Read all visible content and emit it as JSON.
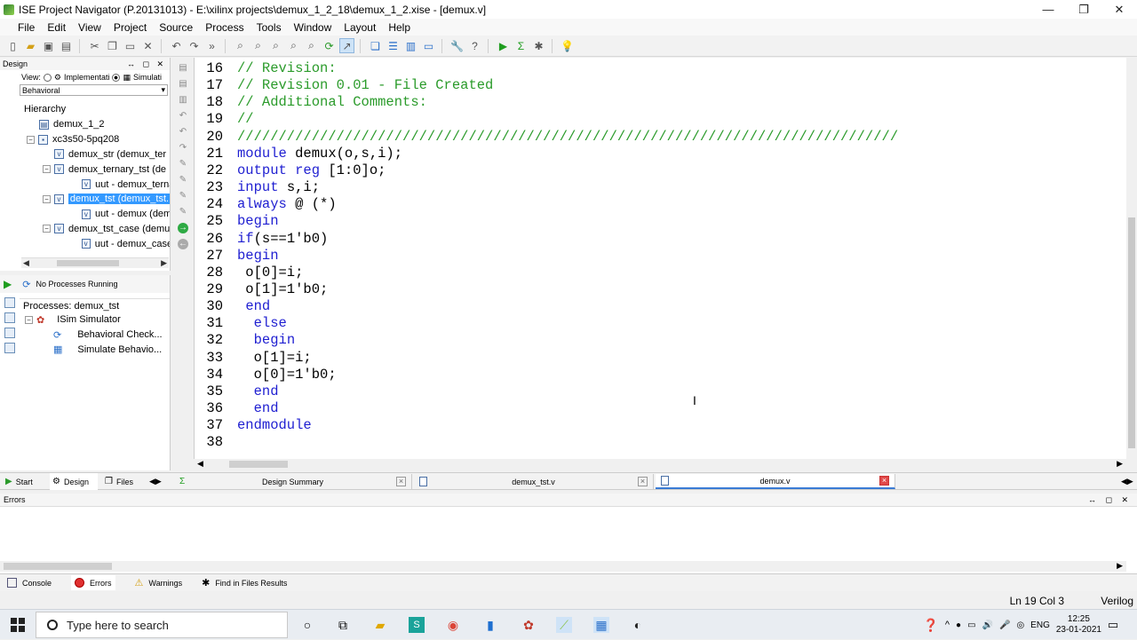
{
  "window": {
    "title": "ISE Project Navigator (P.20131013) - E:\\xilinx projects\\demux_1_2_18\\demux_1_2.xise - [demux.v]",
    "controls": [
      "—",
      "❐",
      "✕"
    ]
  },
  "menu": [
    "File",
    "Edit",
    "View",
    "Project",
    "Source",
    "Process",
    "Tools",
    "Window",
    "Layout",
    "Help"
  ],
  "design_panel": {
    "header": "Design",
    "controls": "↔ ◻ ✕",
    "view_label": "View:",
    "view_impl": "Implementati",
    "view_sim": "Simulati",
    "selected_view": "Behavioral",
    "hierarchy_title": "Hierarchy",
    "tree": [
      {
        "label": "demux_1_2",
        "indent": 1,
        "exp": "",
        "icon": "project"
      },
      {
        "label": "xc3s50-5pq208",
        "indent": 1,
        "exp": "⊟",
        "icon": "chip"
      },
      {
        "label": "demux_str (demux_ter",
        "indent": 2,
        "exp": "",
        "icon": "v"
      },
      {
        "label": "demux_ternary_tst (de",
        "indent": 2,
        "exp": "⊟",
        "icon": "v"
      },
      {
        "label": "uut - demux_ternai",
        "indent": 3,
        "exp": "",
        "icon": "v"
      },
      {
        "label": "demux_tst (demux_tst.",
        "indent": 2,
        "exp": "⊟",
        "icon": "v",
        "selected": true
      },
      {
        "label": "uut - demux (demu",
        "indent": 3,
        "exp": "",
        "icon": "v"
      },
      {
        "label": "demux_tst_case (demu",
        "indent": 2,
        "exp": "⊟",
        "icon": "v"
      },
      {
        "label": "uut - demux_case (",
        "indent": 3,
        "exp": "",
        "icon": "v"
      }
    ]
  },
  "process_panel": {
    "status": "No Processes Running",
    "title": "Processes: demux_tst",
    "items": [
      {
        "label": "ISim Simulator",
        "indent": 1
      },
      {
        "label": "Behavioral Check...",
        "indent": 2
      },
      {
        "label": "Simulate Behavio...",
        "indent": 2
      }
    ]
  },
  "editor": {
    "lines": [
      {
        "n": "16",
        "parts": [
          {
            "t": "// Revision:",
            "c": "cm"
          }
        ]
      },
      {
        "n": "17",
        "parts": [
          {
            "t": "// Revision 0.01 - File Created",
            "c": "cm"
          }
        ]
      },
      {
        "n": "18",
        "parts": [
          {
            "t": "// Additional Comments:",
            "c": "cm"
          }
        ]
      },
      {
        "n": "19",
        "parts": [
          {
            "t": "//",
            "c": "cm"
          }
        ]
      },
      {
        "n": "20",
        "parts": [
          {
            "t": "////////////////////////////////////////////////////////////////////////////////",
            "c": "cm"
          }
        ]
      },
      {
        "n": "21",
        "parts": [
          {
            "t": "module",
            "c": "kw"
          },
          {
            "t": " demux(o,s,i);",
            "c": ""
          }
        ]
      },
      {
        "n": "22",
        "parts": [
          {
            "t": "output reg",
            "c": "kw"
          },
          {
            "t": " [1:0]o;",
            "c": ""
          }
        ]
      },
      {
        "n": "23",
        "parts": [
          {
            "t": "input",
            "c": "kw"
          },
          {
            "t": " s,i;",
            "c": ""
          }
        ]
      },
      {
        "n": "24",
        "parts": [
          {
            "t": "always",
            "c": "kw"
          },
          {
            "t": " @ (*)",
            "c": ""
          }
        ]
      },
      {
        "n": "25",
        "parts": [
          {
            "t": "begin",
            "c": "kw"
          }
        ]
      },
      {
        "n": "26",
        "parts": [
          {
            "t": "if",
            "c": "kw"
          },
          {
            "t": "(s==1'b0)",
            "c": ""
          }
        ]
      },
      {
        "n": "27",
        "parts": [
          {
            "t": "begin",
            "c": "kw"
          }
        ]
      },
      {
        "n": "28",
        "parts": [
          {
            "t": " o[0]=i;",
            "c": ""
          }
        ]
      },
      {
        "n": "29",
        "parts": [
          {
            "t": " o[1]=1'b0;",
            "c": ""
          }
        ]
      },
      {
        "n": "30",
        "parts": [
          {
            "t": " ",
            "c": ""
          },
          {
            "t": "end",
            "c": "kw"
          }
        ]
      },
      {
        "n": "31",
        "parts": [
          {
            "t": "  ",
            "c": ""
          },
          {
            "t": "else",
            "c": "kw"
          }
        ]
      },
      {
        "n": "32",
        "parts": [
          {
            "t": "  ",
            "c": ""
          },
          {
            "t": "begin",
            "c": "kw"
          }
        ]
      },
      {
        "n": "33",
        "parts": [
          {
            "t": "  o[1]=i;",
            "c": ""
          }
        ]
      },
      {
        "n": "34",
        "parts": [
          {
            "t": "  o[0]=1'b0;",
            "c": ""
          }
        ]
      },
      {
        "n": "35",
        "parts": [
          {
            "t": "  ",
            "c": ""
          },
          {
            "t": "end",
            "c": "kw"
          }
        ]
      },
      {
        "n": "36",
        "parts": [
          {
            "t": "  ",
            "c": ""
          },
          {
            "t": "end",
            "c": "kw"
          }
        ]
      },
      {
        "n": "37",
        "parts": [
          {
            "t": "endmodule",
            "c": "kw"
          }
        ]
      },
      {
        "n": "38",
        "parts": []
      }
    ]
  },
  "left_tabs": [
    "Start",
    "Design",
    "Files"
  ],
  "doc_tabs": [
    {
      "label": "Design Summary",
      "active": false
    },
    {
      "label": "demux_tst.v",
      "active": false
    },
    {
      "label": "demux.v",
      "active": true
    }
  ],
  "errors_panel": {
    "header": "Errors",
    "controls": "↔ ◻ ✕"
  },
  "bottom_tabs": [
    "Console",
    "Errors",
    "Warnings",
    "Find in Files Results"
  ],
  "status": {
    "position": "Ln 19 Col 3",
    "language": "Verilog"
  },
  "taskbar": {
    "search_placeholder": "Type here to search",
    "lang": "ENG",
    "time": "12:25",
    "date": "23-01-2021"
  },
  "colors": {
    "comment": "#2b9b2b",
    "keyword": "#1f1fd1",
    "selection": "#3399ff"
  }
}
